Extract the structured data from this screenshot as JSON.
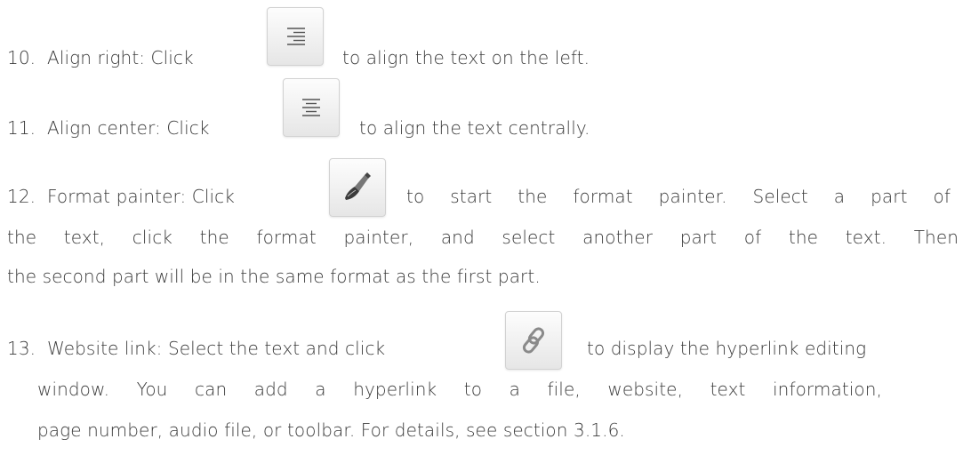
{
  "items": [
    {
      "num": "10.",
      "before": "Align right: Click",
      "after": "to align the text on the left.",
      "icon": "align-right-icon"
    },
    {
      "num": "11.",
      "before": "Align center: Click",
      "after": "to align the text centrally.",
      "icon": "align-center-icon"
    },
    {
      "num": "12.",
      "before": "Format painter: Click",
      "after": "to start the format painter. Select a part of",
      "cont1": "the text, click the format painter, and select another part of the text. Then",
      "cont2": "the second part will be in the same format as the first part.",
      "icon": "paintbrush-icon"
    },
    {
      "num": "13.",
      "before": "Website link: Select the text and click",
      "after": "to display the hyperlink editing",
      "cont1": "window. You can add a hyperlink to a file, website, text information,",
      "cont2": "page number, audio file, or toolbar. For details, see section 3.1.6.",
      "icon": "link-icon"
    }
  ]
}
